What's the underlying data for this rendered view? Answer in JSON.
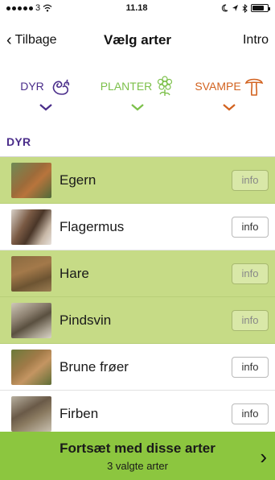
{
  "status": {
    "carrier": "3",
    "time": "11.18"
  },
  "nav": {
    "back_label": "Tilbage",
    "title": "Vælg arter",
    "intro_label": "Intro"
  },
  "categories": [
    {
      "label": "DYR",
      "color": "#4a2d8a",
      "icon": "squirrel-icon"
    },
    {
      "label": "PLANTER",
      "color": "#7cc04a",
      "icon": "flower-icon"
    },
    {
      "label": "SVAMPE",
      "color": "#d2621f",
      "icon": "mushroom-icon"
    }
  ],
  "section_label": "DYR",
  "species": [
    {
      "name": "Egern",
      "info": "info",
      "selected": true
    },
    {
      "name": "Flagermus",
      "info": "info",
      "selected": false
    },
    {
      "name": "Hare",
      "info": "info",
      "selected": true
    },
    {
      "name": "Pindsvin",
      "info": "info",
      "selected": true
    },
    {
      "name": "Brune frøer",
      "info": "info",
      "selected": false
    },
    {
      "name": "Firben",
      "info": "info",
      "selected": false
    }
  ],
  "footer": {
    "main": "Fortsæt med disse arter",
    "sub": "3 valgte arter"
  },
  "colors": {
    "selected_row": "#c6db86",
    "footer": "#8cc63f",
    "accent_purple": "#4a2d8a"
  }
}
